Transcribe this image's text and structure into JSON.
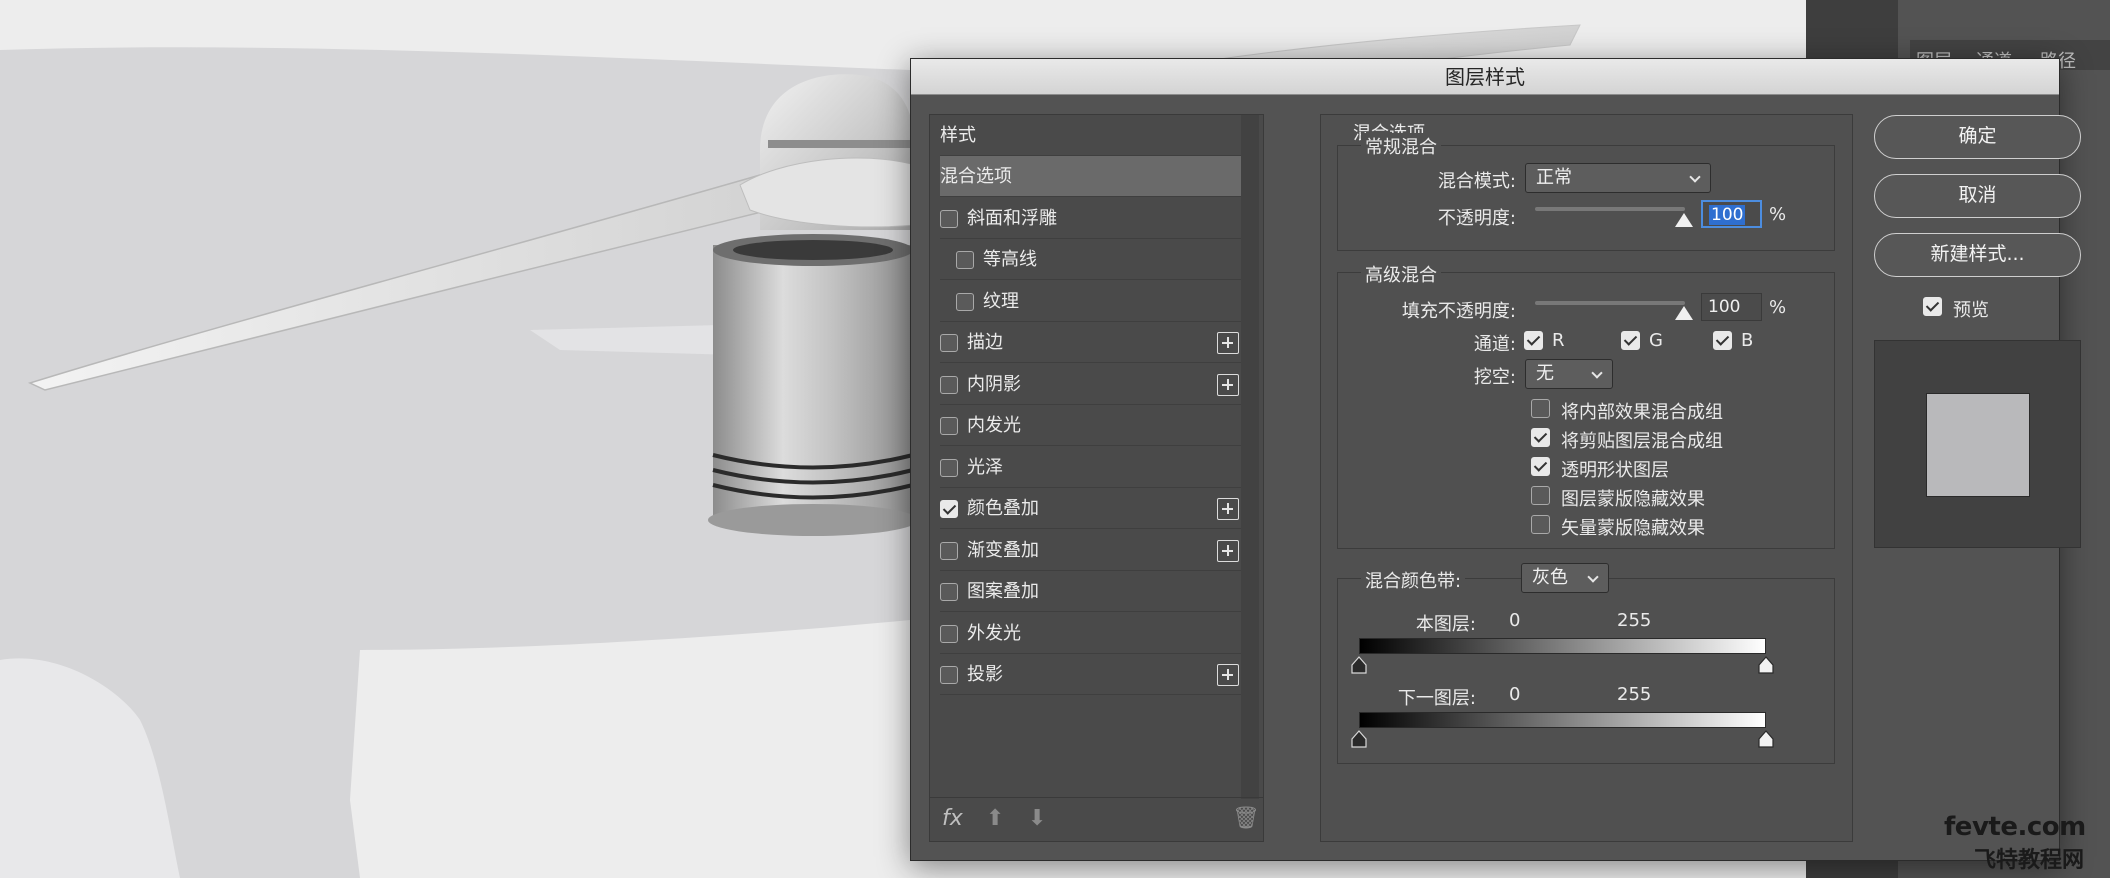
{
  "panel_tabs": [
    "图层",
    "通道",
    "路径"
  ],
  "dialog": {
    "title": "图层样式",
    "styles_list": {
      "header": "样式",
      "items": [
        {
          "label": "混合选项",
          "checkbox": false,
          "selected": true,
          "plus": false
        },
        {
          "label": "斜面和浮雕",
          "checkbox": true,
          "checked": false,
          "plus": false
        },
        {
          "label": "等高线",
          "checkbox": true,
          "checked": false,
          "plus": false,
          "indent": true
        },
        {
          "label": "纹理",
          "checkbox": true,
          "checked": false,
          "plus": false,
          "indent": true
        },
        {
          "label": "描边",
          "checkbox": true,
          "checked": false,
          "plus": true
        },
        {
          "label": "内阴影",
          "checkbox": true,
          "checked": false,
          "plus": true
        },
        {
          "label": "内发光",
          "checkbox": true,
          "checked": false,
          "plus": false
        },
        {
          "label": "光泽",
          "checkbox": true,
          "checked": false,
          "plus": false
        },
        {
          "label": "颜色叠加",
          "checkbox": true,
          "checked": true,
          "plus": true
        },
        {
          "label": "渐变叠加",
          "checkbox": true,
          "checked": false,
          "plus": true
        },
        {
          "label": "图案叠加",
          "checkbox": true,
          "checked": false,
          "plus": false
        },
        {
          "label": "外发光",
          "checkbox": true,
          "checked": false,
          "plus": false
        },
        {
          "label": "投影",
          "checkbox": true,
          "checked": false,
          "plus": true
        }
      ],
      "footer_fx": "fx"
    },
    "blend_options": {
      "section_title": "混合选项",
      "general": {
        "title": "常规混合",
        "blend_mode_label": "混合模式:",
        "blend_mode_value": "正常",
        "opacity_label": "不透明度:",
        "opacity_value": "100",
        "opacity_unit": "%"
      },
      "advanced": {
        "title": "高级混合",
        "fill_opacity_label": "填充不透明度:",
        "fill_opacity_value": "100",
        "fill_opacity_unit": "%",
        "channels_label": "通道:",
        "channel_r": "R",
        "channel_g": "G",
        "channel_b": "B",
        "knockout_label": "挖空:",
        "knockout_value": "无",
        "options": [
          {
            "label": "将内部效果混合成组",
            "checked": false
          },
          {
            "label": "将剪贴图层混合成组",
            "checked": true
          },
          {
            "label": "透明形状图层",
            "checked": true
          },
          {
            "label": "图层蒙版隐藏效果",
            "checked": false
          },
          {
            "label": "矢量蒙版隐藏效果",
            "checked": false
          }
        ]
      },
      "blend_if": {
        "label": "混合颜色带:",
        "value": "灰色",
        "this_layer_label": "本图层:",
        "this_layer_min": "0",
        "this_layer_max": "255",
        "underlying_label": "下一图层:",
        "underlying_min": "0",
        "underlying_max": "255"
      }
    },
    "buttons": {
      "ok": "确定",
      "cancel": "取消",
      "new_style": "新建样式...",
      "preview_label": "预览"
    },
    "preview_swatch_color": "#b9b9bb"
  },
  "watermark": {
    "line1": "fevte.com",
    "line2": "飞特教程网"
  }
}
